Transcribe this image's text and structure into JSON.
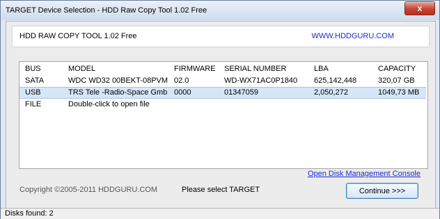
{
  "window": {
    "title": "TARGET Device Selection - HDD Raw Copy Tool 1.02   Free",
    "close_glyph": "x"
  },
  "header": {
    "app_name": "HDD RAW COPY TOOL 1.02   Free",
    "website": "WWW.HDDGURU.COM"
  },
  "table": {
    "columns": [
      "BUS",
      "MODEL",
      "FIRMWARE",
      "SERIAL NUMBER",
      "LBA",
      "CAPACITY"
    ],
    "rows": [
      {
        "bus": "SATA",
        "model": "WDC WD32 00BEKT-08PVM",
        "firmware": "02.0",
        "serial": "WD-WX71AC0P1840",
        "lba": "625,142,448",
        "capacity": "320,07 GB"
      },
      {
        "bus": "USB",
        "model": "TRS Tele -Radio-Space Gmb",
        "firmware": "0000",
        "serial": "01347059",
        "lba": "2,050,272",
        "capacity": "1049,73 MB"
      },
      {
        "bus": "FILE",
        "model": "Double-click to open file",
        "firmware": "",
        "serial": "",
        "lba": "",
        "capacity": ""
      }
    ],
    "selected_row": 1
  },
  "footer": {
    "disk_mgmt_link": "Open Disk Management Console",
    "copyright": "Copyright ©2005-2011 HDDGURU.COM",
    "status_message": "Please select TARGET",
    "continue_label": "Continue >>>"
  },
  "statusbar": {
    "text": "Disks found: 2"
  },
  "colors": {
    "link": "#1a2ad8",
    "selection": "#d6e6f8",
    "close_button": "#c74432"
  }
}
